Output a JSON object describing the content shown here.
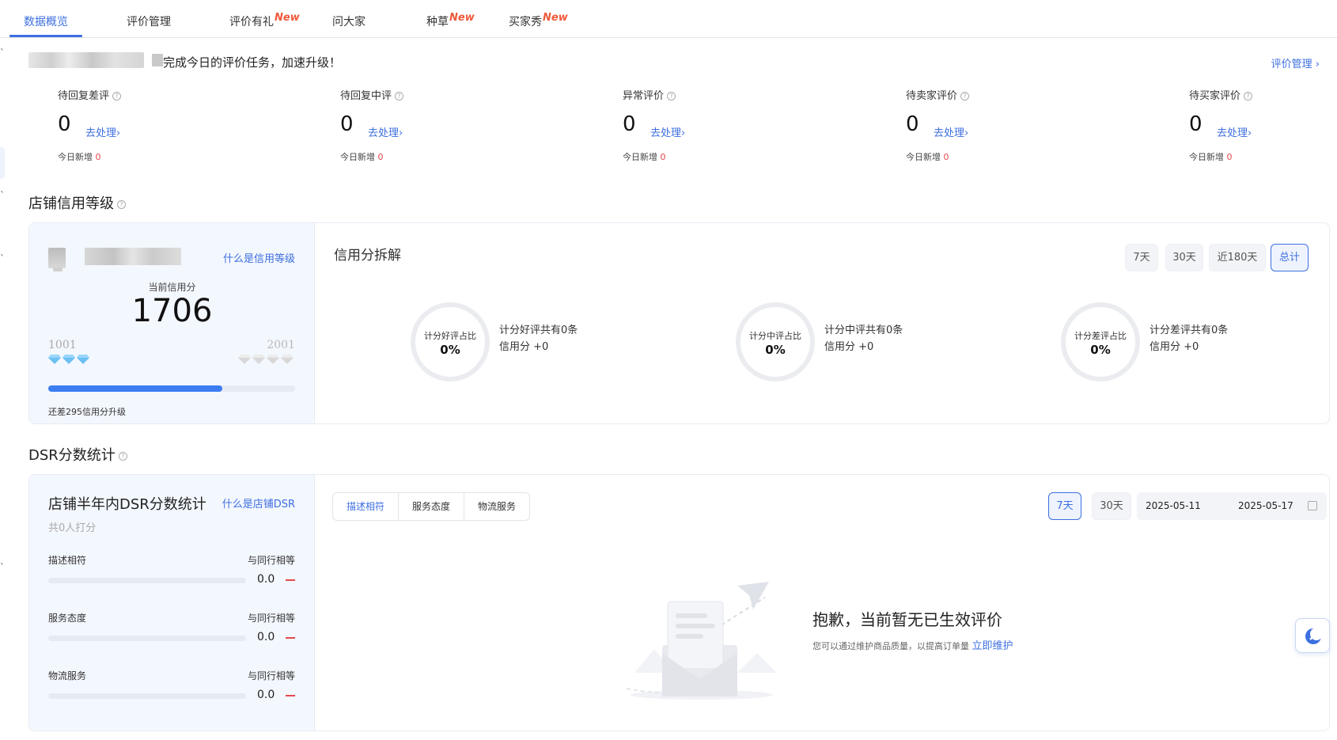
{
  "tabs": [
    {
      "label": "数据概览",
      "badge": ""
    },
    {
      "label": "评价管理",
      "badge": ""
    },
    {
      "label": "评价有礼",
      "badge": "New"
    },
    {
      "label": "问大家",
      "badge": ""
    },
    {
      "label": "种草",
      "badge": "New"
    },
    {
      "label": "买家秀",
      "badge": "New"
    }
  ],
  "notice": {
    "text": "完成今日的评价任务，加速升级！",
    "link": "评价管理"
  },
  "stats": [
    {
      "label": "待回复差评",
      "value": "0",
      "link": "去处理",
      "today_label": "今日新增",
      "today_value": "0"
    },
    {
      "label": "待回复中评",
      "value": "0",
      "link": "去处理",
      "today_label": "今日新增",
      "today_value": "0"
    },
    {
      "label": "异常评价",
      "value": "0",
      "link": "去处理",
      "today_label": "今日新增",
      "today_value": "0"
    },
    {
      "label": "待卖家评价",
      "value": "0",
      "link": "去处理",
      "today_label": "今日新增",
      "today_value": "0"
    },
    {
      "label": "待买家评价",
      "value": "0",
      "link": "去处理",
      "today_label": "今日新增",
      "today_value": "0"
    }
  ],
  "credit": {
    "section_title": "店铺信用等级",
    "what_link": "什么是信用等级",
    "current_label": "当前信用分",
    "score": "1706",
    "level_min": "1001",
    "level_max": "2001",
    "progress_fraction": 0.705,
    "upgrade_text": "还差295信用分升级",
    "breakdown_title": "信用分拆解",
    "ranges": [
      "7天",
      "30天",
      "近180天",
      "总计"
    ],
    "active_range": "总计",
    "rings": [
      {
        "label": "计分好评占比",
        "value": "0%",
        "line1": "计分好评共有0条",
        "line2": "信用分 +0"
      },
      {
        "label": "计分中评占比",
        "value": "0%",
        "line1": "计分中评共有0条",
        "line2": "信用分 +0"
      },
      {
        "label": "计分差评占比",
        "value": "0%",
        "line1": "计分差评共有0条",
        "line2": "信用分 +0"
      }
    ]
  },
  "dsr": {
    "section_title": "DSR分数统计",
    "card_title": "店铺半年内DSR分数统计",
    "what_link": "什么是店铺DSR",
    "count_text": "共0人打分",
    "rows": [
      {
        "label": "描述相符",
        "compare": "与同行相等",
        "value": "0.0"
      },
      {
        "label": "服务态度",
        "compare": "与同行相等",
        "value": "0.0"
      },
      {
        "label": "物流服务",
        "compare": "与同行相等",
        "value": "0.0"
      }
    ],
    "segments": [
      "描述相符",
      "服务态度",
      "物流服务"
    ],
    "active_segment": "描述相符",
    "days": [
      "7天",
      "30天"
    ],
    "active_day": "7天",
    "date_start": "2025-05-11",
    "date_end": "2025-05-17",
    "empty_title": "抱歉，当前暂无已生效评价",
    "empty_sub": "您可以通过维护商品质量，以提高订单量",
    "empty_link": "立即维护"
  },
  "colors": {
    "accent": "#3d6fe0",
    "new_badge": "#f05a3c",
    "red": "#e5484d",
    "card_bg": "#f3f7fe",
    "progress": "#3d7df2"
  },
  "icons": {
    "help": "help-circle-icon",
    "chevron": "chevron-right-icon",
    "calendar": "calendar-icon",
    "gem": "diamond-icon",
    "float": "moon-chat-icon"
  }
}
